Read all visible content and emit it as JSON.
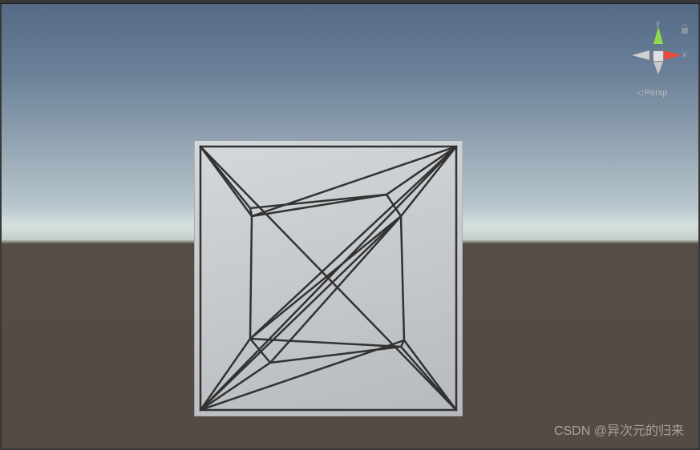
{
  "viewport": {
    "projection_mode": "Persp",
    "axis_labels": {
      "x": "x",
      "y": "y"
    }
  },
  "watermark": {
    "prefix": "CSDN",
    "handle": "@异次元的归来"
  }
}
